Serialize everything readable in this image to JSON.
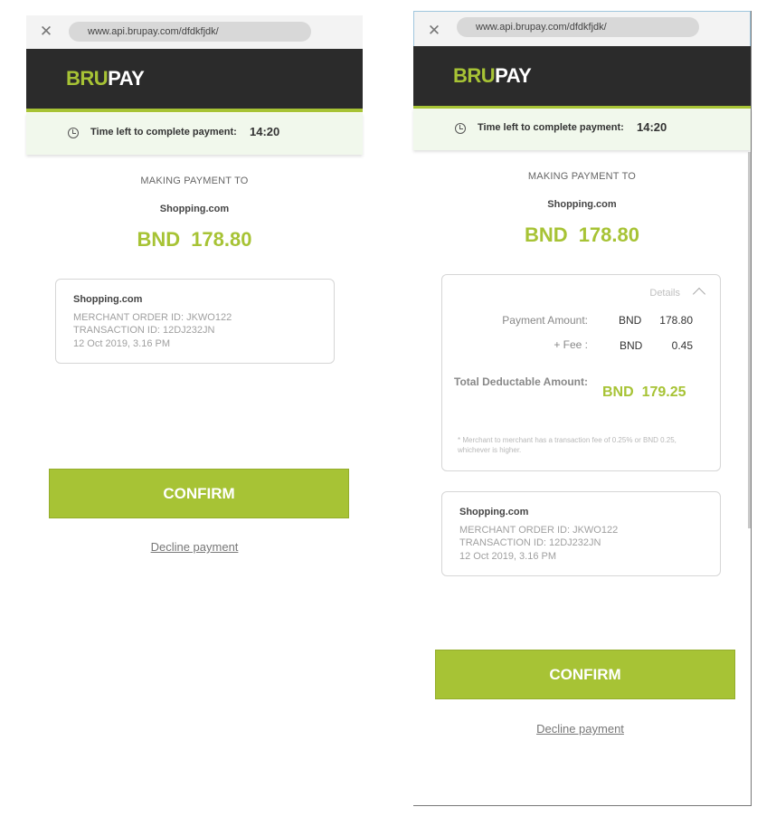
{
  "left": {
    "url": "www.api.brupay.com/dfdkfjdk/",
    "logo": {
      "bru": "BRU",
      "pay": "PAY"
    },
    "timer": {
      "label": "Time left to complete payment:",
      "value": "14:20"
    },
    "making_label": "MAKING PAYMENT TO",
    "merchant": "Shopping.com",
    "amount": {
      "currency": "BND",
      "value": "178.80"
    },
    "card": {
      "merchant": "Shopping.com",
      "order_id": "MERCHANT ORDER ID: JKWO122",
      "transaction_id": "TRANSACTION ID: 12DJ232JN",
      "date": "12 Oct 2019, 3.16 PM"
    },
    "confirm_label": "CONFIRM",
    "decline_label": "Decline payment"
  },
  "right": {
    "url": "www.api.brupay.com/dfdkfjdk/",
    "logo": {
      "bru": "BRU",
      "pay": "PAY"
    },
    "timer": {
      "label": "Time left to complete payment:",
      "value": "14:20"
    },
    "making_label": "MAKING PAYMENT TO",
    "merchant": "Shopping.com",
    "amount": {
      "currency": "BND",
      "value": "178.80"
    },
    "details": {
      "toggle_label": "Details",
      "payment_amount_label": "Payment Amount:",
      "payment_currency": "BND",
      "payment_value": "178.80",
      "fee_label": "+ Fee :",
      "fee_currency": "BND",
      "fee_value": "0.45",
      "total_label": "Total Deductable Amount:",
      "total_currency": "BND",
      "total_value": "179.25",
      "note": "* Merchant to merchant has a transaction fee of 0.25% or BND 0.25, whichever is higher."
    },
    "card": {
      "merchant": "Shopping.com",
      "order_id": "MERCHANT ORDER ID: JKWO122",
      "transaction_id": "TRANSACTION ID: 12DJ232JN",
      "date": "12 Oct 2019, 3.16 PM"
    },
    "confirm_label": "CONFIRM",
    "decline_label": "Decline payment"
  },
  "colors": {
    "brand_green": "#a7c335",
    "header_dark": "#2b2b2b",
    "timer_bg": "#f1f8ec"
  },
  "icons": [
    "close-icon",
    "clock-icon",
    "chevron-up-icon"
  ]
}
